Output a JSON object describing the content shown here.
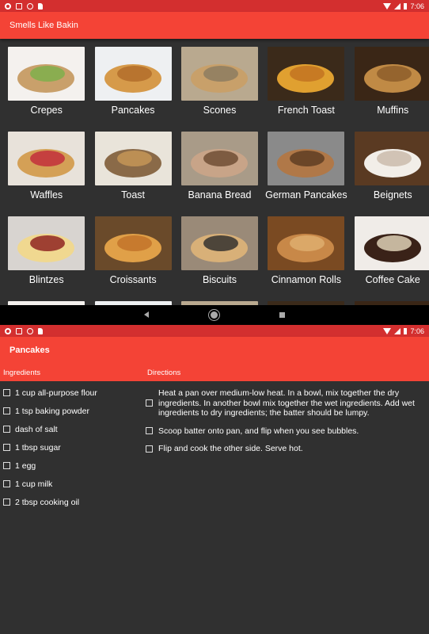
{
  "status": {
    "time": "7:06"
  },
  "app": {
    "title": "Smells Like Bakin"
  },
  "recipes": [
    {
      "label": "Crepes"
    },
    {
      "label": "Pancakes"
    },
    {
      "label": "Scones"
    },
    {
      "label": "French Toast"
    },
    {
      "label": "Muffins"
    },
    {
      "label": "Waffles"
    },
    {
      "label": "Toast"
    },
    {
      "label": "Banana Bread"
    },
    {
      "label": "German Pancakes"
    },
    {
      "label": "Beignets"
    },
    {
      "label": "Blintzes"
    },
    {
      "label": "Croissants"
    },
    {
      "label": "Biscuits"
    },
    {
      "label": "Cinnamon Rolls"
    },
    {
      "label": "Coffee Cake"
    }
  ],
  "detail": {
    "title": "Pancakes",
    "ingredients_header": "Ingredients",
    "directions_header": "Directions",
    "ingredients": [
      "1 cup all-purpose flour",
      "1 tsp baking powder",
      "dash of salt",
      "1 tbsp sugar",
      "1 egg",
      "1 cup milk",
      "2 tbsp cooking oil"
    ],
    "directions": [
      "Heat a pan over medium-low heat. In a bowl, mix together the dry ingredients. In another bowl mix together the wet ingredients. Add wet ingredients to dry ingredients; the batter should be lumpy.",
      "Scoop batter onto pan, and flip when you see bubbles.",
      "Flip and cook the other side. Serve hot."
    ]
  },
  "colors": {
    "appbar": "#f44336",
    "statusbar": "#d32f2f",
    "background": "#303030"
  }
}
